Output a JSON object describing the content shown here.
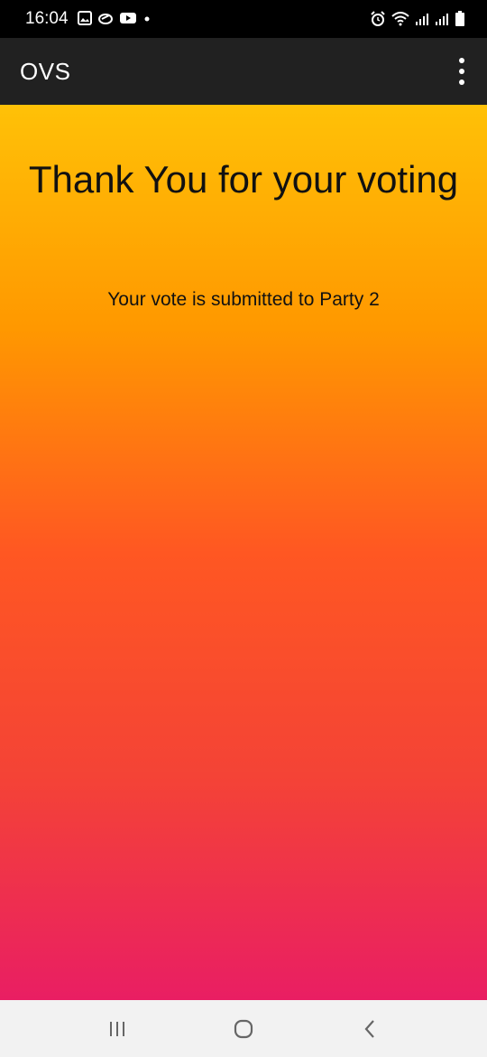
{
  "status_bar": {
    "time": "16:04",
    "left_icons": [
      "gallery-icon",
      "link-icon",
      "youtube-icon",
      "notification-dot-icon"
    ],
    "right_icons": [
      "alarm-icon",
      "wifi-icon",
      "signal-icon",
      "signal-icon",
      "battery-icon"
    ]
  },
  "app_bar": {
    "title": "OVS",
    "menu_icon": "more-vert-icon"
  },
  "main": {
    "title": "Thank You for your voting",
    "message": "Your vote is submitted to Party 2",
    "gradient_colors": [
      "#FFC107",
      "#FF9800",
      "#FF5722",
      "#F44336",
      "#E91E63"
    ]
  },
  "nav_bar": {
    "buttons": [
      "recent-apps-icon",
      "home-icon",
      "back-icon"
    ]
  }
}
